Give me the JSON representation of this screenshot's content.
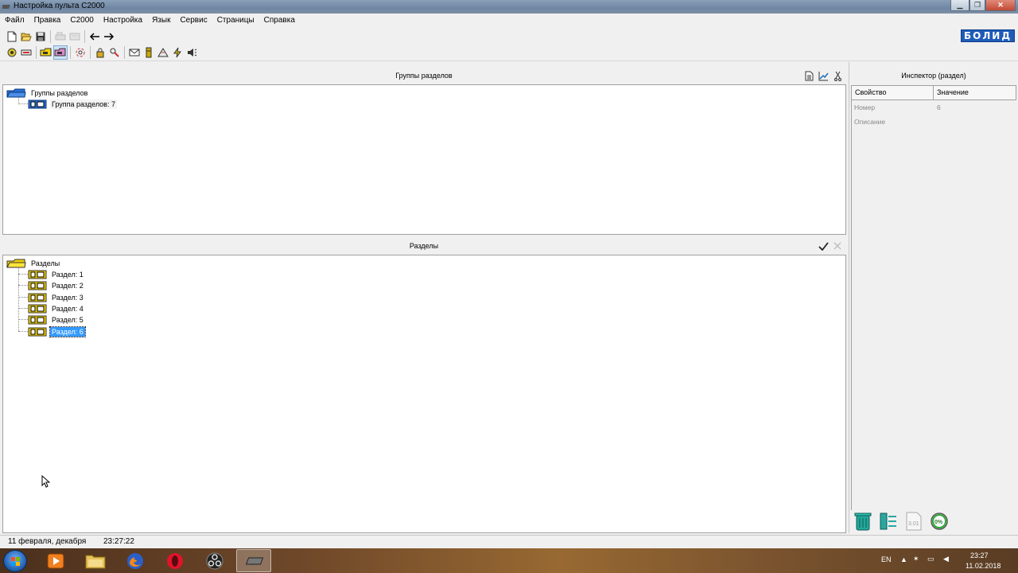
{
  "window": {
    "title": "Настройка пульта С2000"
  },
  "menu": [
    "Файл",
    "Правка",
    "С2000",
    "Настройка",
    "Язык",
    "Сервис",
    "Страницы",
    "Справка"
  ],
  "brand": "БОЛИД",
  "groups_panel": {
    "title": "Группы разделов",
    "root": "Группы разделов",
    "items": [
      "Группа разделов: 7"
    ]
  },
  "sections_panel": {
    "title": "Разделы",
    "root": "Разделы",
    "items": [
      "Раздел: 1",
      "Раздел: 2",
      "Раздел: 3",
      "Раздел: 4",
      "Раздел: 5",
      "Раздел: 6"
    ],
    "selected_index": 5
  },
  "inspector": {
    "title": "Инспектор (раздел)",
    "col_property": "Свойство",
    "col_value": "Значение",
    "rows": [
      {
        "property": "Номер",
        "value": "6"
      },
      {
        "property": "Описание",
        "value": ""
      }
    ]
  },
  "status": {
    "date": "11 февраля, декабря",
    "time": "23:27:22"
  },
  "bottom_icons": {
    "version": "3.01",
    "percent": "0%"
  },
  "taskbar": {
    "lang": "EN",
    "clock_time": "23:27",
    "clock_date": "11.02.2018"
  },
  "colors": {
    "selection": "#3399ff",
    "brand": "#1f5cb8",
    "folder_blue": "#2a6fd6",
    "folder_yellow": "#f2d200"
  }
}
